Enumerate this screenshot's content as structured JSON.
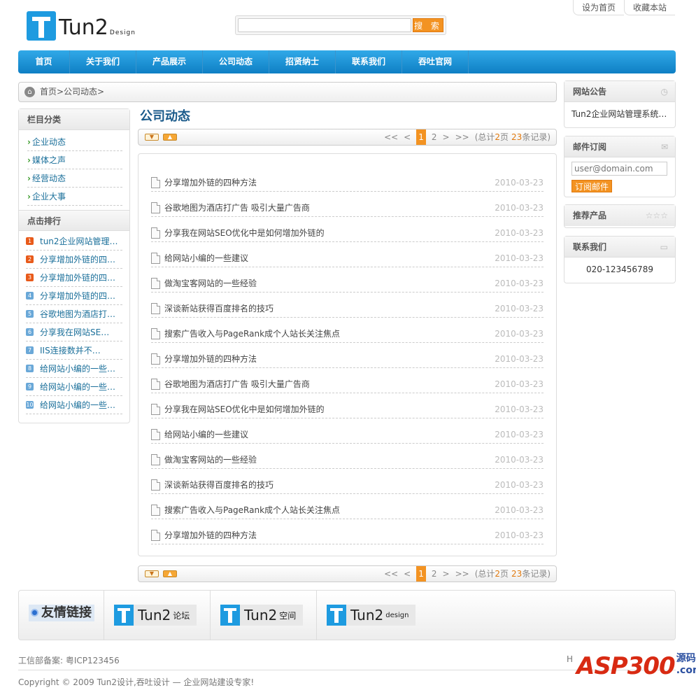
{
  "top_links": [
    "设为首页",
    "收藏本站"
  ],
  "logo": {
    "text": "Tun2",
    "sub": "Design"
  },
  "search": {
    "button": "搜 索",
    "value": ""
  },
  "nav": [
    "首页",
    "关于我们",
    "产品展示",
    "公司动态",
    "招贤纳士",
    "联系我们",
    "吞吐官网"
  ],
  "breadcrumb": "首页>公司动态>",
  "left": {
    "category_title": "栏目分类",
    "categories": [
      "企业动态",
      "媒体之声",
      "经营动态",
      "企业大事"
    ],
    "rank_title": "点击排行",
    "ranks": [
      {
        "n": "1",
        "t": "tun2企业网站管理…",
        "color": "#e85a1a"
      },
      {
        "n": "2",
        "t": "分享增加外链的四…",
        "color": "#e85a1a"
      },
      {
        "n": "3",
        "t": "分享增加外链的四…",
        "color": "#e85a1a"
      },
      {
        "n": "4",
        "t": "分享增加外链的四…",
        "color": "#6aa8d8"
      },
      {
        "n": "5",
        "t": "谷歌地图为酒店打…",
        "color": "#6aa8d8"
      },
      {
        "n": "6",
        "t": "分享我在网站SE…",
        "color": "#6aa8d8"
      },
      {
        "n": "7",
        "t": "IIS连接数并不…",
        "color": "#6aa8d8"
      },
      {
        "n": "8",
        "t": "给网站小编的一些…",
        "color": "#6aa8d8"
      },
      {
        "n": "9",
        "t": "给网站小编的一些…",
        "color": "#6aa8d8"
      },
      {
        "n": "10",
        "t": "给网站小编的一些…",
        "color": "#6aa8d8"
      }
    ]
  },
  "main": {
    "title": "公司动态",
    "pager": {
      "prev_all": "<<",
      "prev": "<",
      "current": "1",
      "next_page": "2",
      "next": ">",
      "next_all": ">>",
      "total_a": "(总计",
      "pages": "2",
      "total_b": "页",
      "count": "23",
      "total_c": "条记录)"
    },
    "articles": [
      {
        "title": "分享增加外链的四种方法",
        "date": "2010-03-23"
      },
      {
        "title": "谷歌地图为酒店打广告 吸引大量广告商",
        "date": "2010-03-23"
      },
      {
        "title": "分享我在网站SEO优化中是如何增加外链的",
        "date": "2010-03-23"
      },
      {
        "title": "给网站小编的一些建议",
        "date": "2010-03-23"
      },
      {
        "title": "做淘宝客网站的一些经验",
        "date": "2010-03-23"
      },
      {
        "title": "深谈新站获得百度排名的技巧",
        "date": "2010-03-23"
      },
      {
        "title": "搜索广告收入与PageRank成个人站长关注焦点",
        "date": "2010-03-23"
      },
      {
        "title": "分享增加外链的四种方法",
        "date": "2010-03-23"
      },
      {
        "title": "谷歌地图为酒店打广告 吸引大量广告商",
        "date": "2010-03-23"
      },
      {
        "title": "分享我在网站SEO优化中是如何增加外链的",
        "date": "2010-03-23"
      },
      {
        "title": "给网站小编的一些建议",
        "date": "2010-03-23"
      },
      {
        "title": "做淘宝客网站的一些经验",
        "date": "2010-03-23"
      },
      {
        "title": "深谈新站获得百度排名的技巧",
        "date": "2010-03-23"
      },
      {
        "title": "搜索广告收入与PageRank成个人站长关注焦点",
        "date": "2010-03-23"
      },
      {
        "title": "分享增加外链的四种方法",
        "date": "2010-03-23"
      }
    ]
  },
  "right": {
    "notice_title": "网站公告",
    "notice_text": "Tun2企业网站管理系统…",
    "mail_title": "邮件订阅",
    "mail_placeholder": "user@domain.com",
    "mail_button": "订阅邮件",
    "product_title": "推荐产品",
    "product_icon": "☆☆☆",
    "contact_title": "联系我们",
    "contact_phone": "020-123456789"
  },
  "links": {
    "title": "友情链接",
    "partners": [
      {
        "name": "Tun2",
        "sub": "论坛"
      },
      {
        "name": "Tun2",
        "sub": "空间"
      },
      {
        "name": "Tun2",
        "sub": "design"
      }
    ]
  },
  "footer": {
    "icp": "工信部备案: 粤ICP123456",
    "copyright": "Copyright © 2009 Tun2设计,吞吐设计 — 企业网站建设专家!",
    "right_fragment": "H",
    "watermark_main": "ASP300",
    "watermark_sub": "源码 .com"
  }
}
